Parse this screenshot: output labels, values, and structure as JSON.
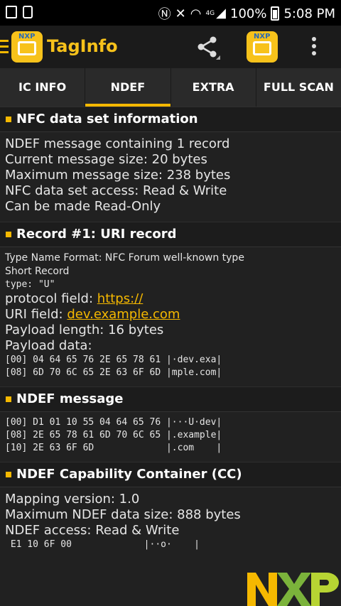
{
  "statusbar": {
    "battery": "100%",
    "time": "5:08 PM",
    "network": "4G"
  },
  "toolbar": {
    "app_title": "TagInfo",
    "logo_brand": "NXP"
  },
  "tabs": [
    {
      "label": "IC INFO",
      "active": false
    },
    {
      "label": "NDEF",
      "active": true
    },
    {
      "label": "EXTRA",
      "active": false
    },
    {
      "label": "FULL SCAN",
      "active": false
    }
  ],
  "sections": {
    "nfc_info": {
      "title": "NFC data set information",
      "lines": [
        "NDEF message containing 1 record",
        "Current message size: 20 bytes",
        "Maximum message size: 238 bytes",
        "NFC data set access: Read & Write",
        "Can be made Read-Only"
      ]
    },
    "record1": {
      "title": "Record #1: URI record",
      "tnf": "Type Name Format: NFC Forum well-known type",
      "short_record": "Short Record",
      "type": "type: \"U\"",
      "protocol_label": "protocol field: ",
      "protocol_value": "https://",
      "uri_label": "URI field: ",
      "uri_value": "dev.example.com",
      "payload_length": "Payload length: 16 bytes",
      "payload_data_label": "Payload data:",
      "hex": [
        "[00] 04 64 65 76 2E 65 78 61 |·dev.exa|",
        "[08] 6D 70 6C 65 2E 63 6F 6D |mple.com|"
      ]
    },
    "ndef_message": {
      "title": "NDEF message",
      "hex": [
        "[00] D1 01 10 55 04 64 65 76 |···U·dev|",
        "[08] 2E 65 78 61 6D 70 6C 65 |.example|",
        "[10] 2E 63 6F 6D             |.com    |"
      ]
    },
    "cc": {
      "title": "NDEF Capability Container (CC)",
      "lines": [
        "Mapping version: 1.0",
        "Maximum NDEF data size: 888 bytes",
        "NDEF access: Read & Write"
      ],
      "hex": " E1 10 6F 00             |··o·    |"
    }
  },
  "footer": {
    "logo": "NXP"
  },
  "colors": {
    "accent": "#f5b800",
    "background": "#212121"
  }
}
